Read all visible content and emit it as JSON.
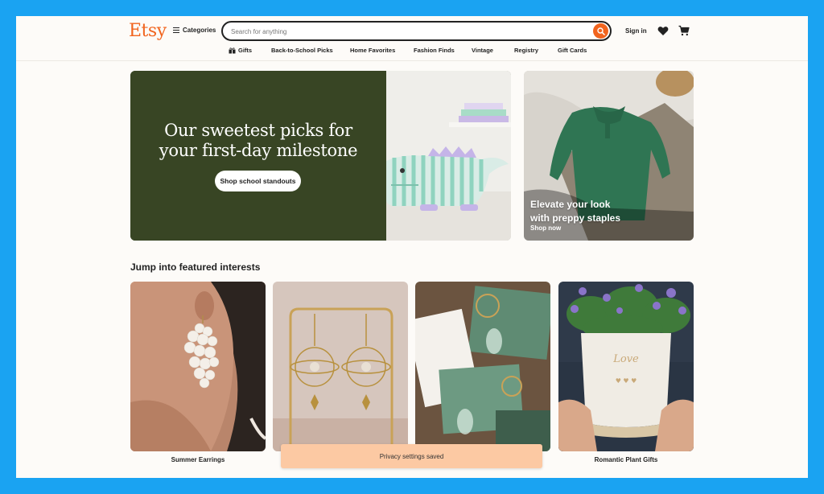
{
  "header": {
    "logo": "Etsy",
    "categories_label": "Categories",
    "search_placeholder": "Search for anything",
    "signin_label": "Sign in"
  },
  "nav": {
    "items": [
      "Gifts",
      "Back-to-School Picks",
      "Home Favorites",
      "Fashion Finds",
      "Vintage",
      "Registry",
      "Gift Cards"
    ]
  },
  "hero": {
    "title_line1": "Our sweetest picks for",
    "title_line2": "your first-day milestone",
    "button_label": "Shop school standouts",
    "side_caption_line1": "Elevate your look",
    "side_caption_line2": "with preppy staples",
    "side_link": "Shop now"
  },
  "featured": {
    "title": "Jump into featured interests",
    "cards": [
      {
        "label": "Summer Earrings"
      },
      {
        "label": ""
      },
      {
        "label": ""
      },
      {
        "label": "Romantic Plant Gifts"
      }
    ]
  },
  "toast": {
    "message": "Privacy settings saved"
  },
  "colors": {
    "brand": "#f1641e",
    "hero_green": "#384524",
    "toast": "#fcc9a3",
    "frame": "#1aa3f2"
  }
}
